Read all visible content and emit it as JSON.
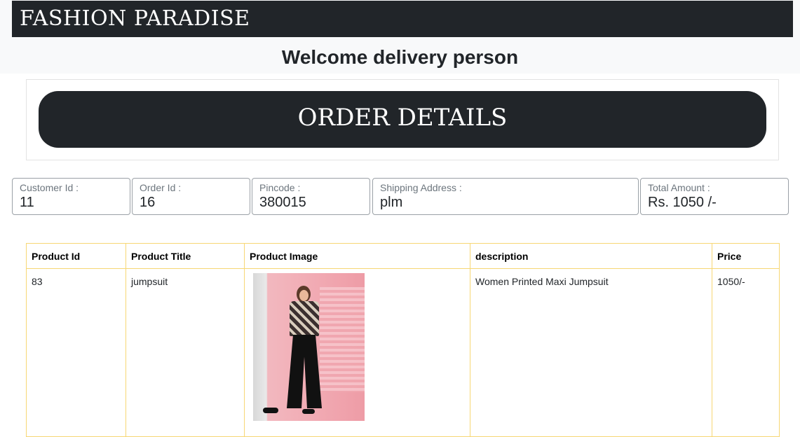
{
  "header": {
    "brand": "FASHION PARADISE",
    "welcome": "Welcome delivery person"
  },
  "order_card": {
    "title": "ORDER DETAILS"
  },
  "fields": [
    {
      "label": "Customer Id :",
      "value": "11"
    },
    {
      "label": "Order Id :",
      "value": "16"
    },
    {
      "label": "Pincode :",
      "value": "380015"
    },
    {
      "label": "Shipping Address :",
      "value": "plm"
    },
    {
      "label": "Total Amount :",
      "value": "Rs. 1050 /-"
    }
  ],
  "table": {
    "headers": [
      "Product Id",
      "Product Title",
      "Product Image",
      "description",
      "Price"
    ],
    "rows": [
      {
        "product_id": "83",
        "product_title": "jumpsuit",
        "description": "Women Printed Maxi Jumpsuit",
        "price": "1050/-"
      }
    ]
  },
  "colors": {
    "dark": "#212529",
    "table_border": "#f7d774",
    "top_bg": "#f8f9fa"
  }
}
